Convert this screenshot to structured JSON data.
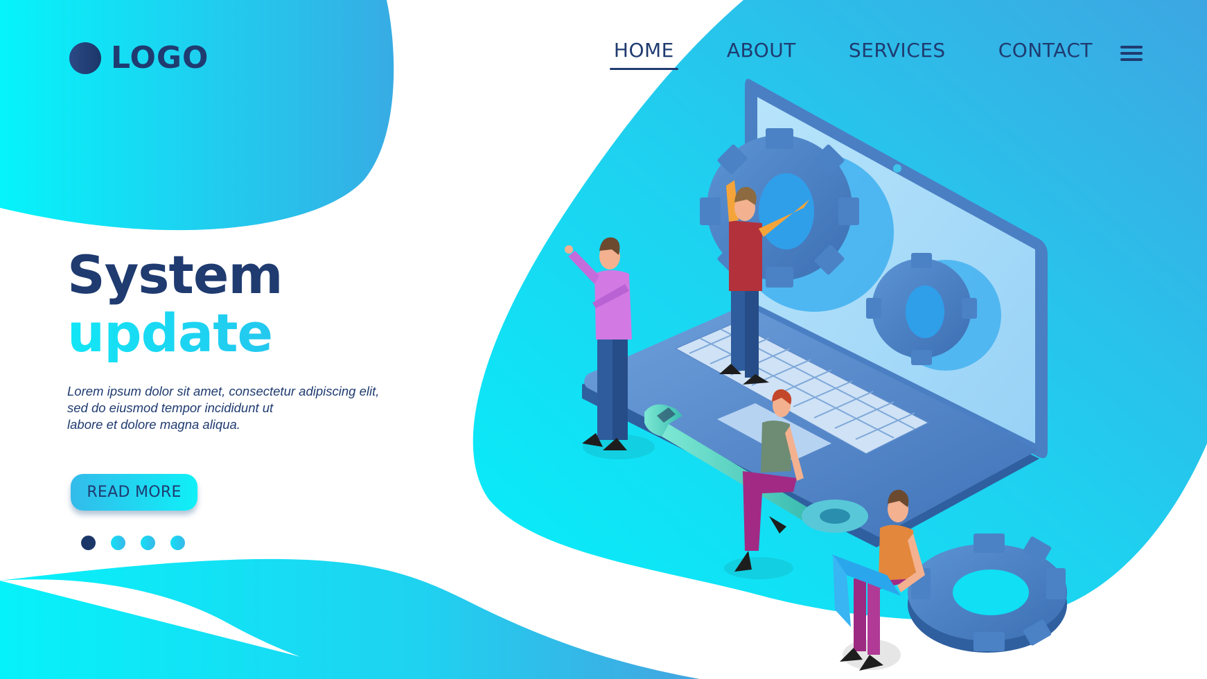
{
  "brand": {
    "logo_text": "LOGO",
    "logo_icon": "circle-logo-mark"
  },
  "nav": {
    "items": [
      {
        "label": "HOME",
        "active": true
      },
      {
        "label": "ABOUT",
        "active": false
      },
      {
        "label": "SERVICES",
        "active": false
      },
      {
        "label": "CONTACT",
        "active": false
      }
    ],
    "menu_icon": "hamburger-menu-icon"
  },
  "hero": {
    "title": "System",
    "subtitle": "update",
    "body_lines": [
      "Lorem ipsum dolor sit amet, consectetur adipiscing elit,",
      "sed do eiusmod tempor incididunt ut",
      "labore et dolore magna aliqua."
    ],
    "cta_label": "READ MORE"
  },
  "carousel": {
    "total": 4,
    "active_index": 0
  },
  "illustration": {
    "subject": "Isometric team repairing a laptop with gears and a wrench",
    "elements": [
      "laptop",
      "screen-gear-large",
      "screen-gear-small",
      "floor-gear",
      "wrench",
      "person-pointing",
      "person-holding-gear",
      "woman-sitting-on-wrench",
      "man-with-laptop"
    ]
  },
  "colors": {
    "navy": "#1f3b70",
    "cyan": "#0ff0f8",
    "blue": "#33aee6",
    "laptop_body": "#4a7fc4",
    "screen": "#a9dcf8",
    "gear": "#4b82c6"
  }
}
